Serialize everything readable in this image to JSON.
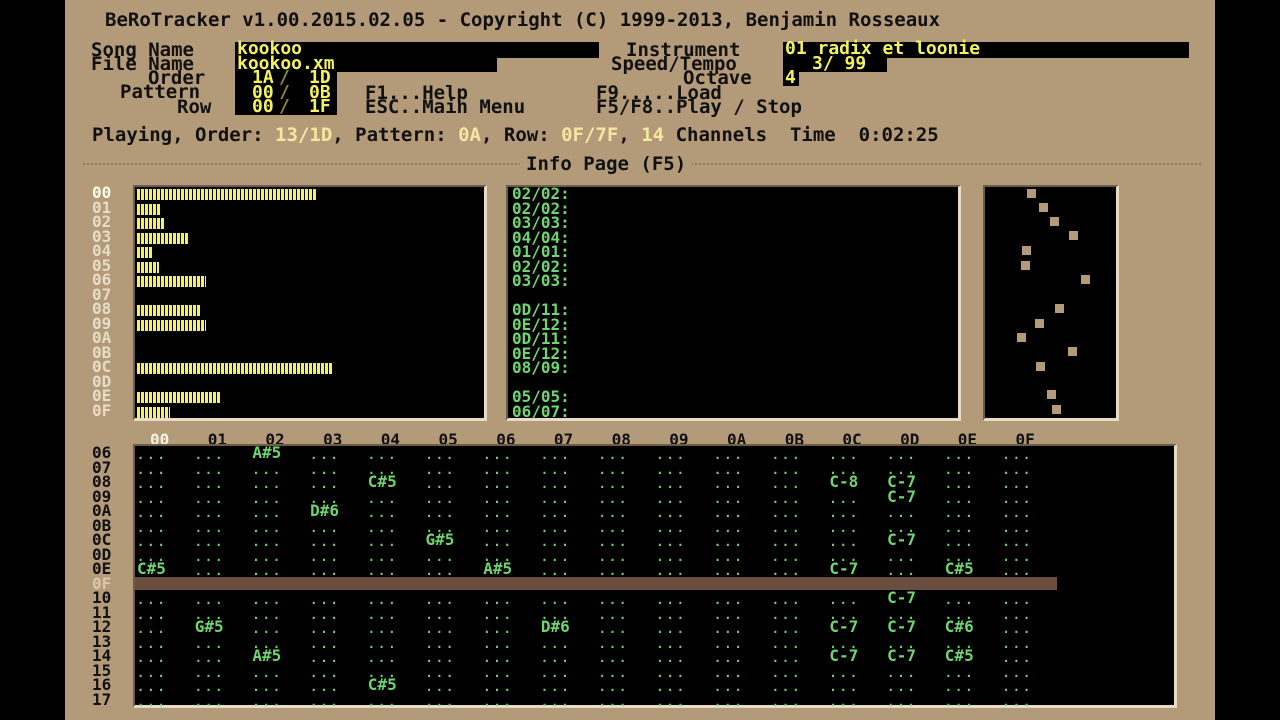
{
  "header": {
    "title": "BeRoTracker v1.00.2015.02.05 - Copyright (C) 1999-2013, Benjamin Rosseaux"
  },
  "song": {
    "song_name_label": "Song Name",
    "song_name": "kookoo",
    "file_name_label": "File Name",
    "file_name": "kookoo.xm",
    "order_label": "Order",
    "order_value": "1A",
    "order_total": "1D",
    "pattern_label": "Pattern",
    "pattern_value": "00",
    "pattern_total": "0B",
    "row_label": "Row",
    "row_value": "00",
    "row_total": "1F",
    "instrument_label": "Instrument",
    "instrument_value": "01 radix et loonie",
    "speed_label": "Speed/Tempo",
    "speed_value": "3/ 99",
    "octave_label": "Octave",
    "octave_value": "4"
  },
  "shortcuts": {
    "help": "F1...Help",
    "main_menu": "ESC..Main Menu",
    "load": "F9.....Load",
    "play_stop": "F5/F8..Play / Stop"
  },
  "status": {
    "playing_label": "Playing, Order:",
    "order_cur": "13",
    "order_total": "/1D",
    "pattern_label": ", Pattern:",
    "pattern": "0A",
    "row_label": ", Row:",
    "row_cur": "0F",
    "row_total": "/7F",
    "channels_sep": ",",
    "channels": "14",
    "channels_label": "Channels",
    "time_label": "Time",
    "time": "0:02:25"
  },
  "info_page": {
    "title": "Info Page (F5)"
  },
  "channels": [
    {
      "id": "00",
      "level": 0.92
    },
    {
      "id": "01",
      "level": 0.12
    },
    {
      "id": "02",
      "level": 0.14
    },
    {
      "id": "03",
      "level": 0.26
    },
    {
      "id": "04",
      "level": 0.08
    },
    {
      "id": "05",
      "level": 0.11
    },
    {
      "id": "06",
      "level": 0.35
    },
    {
      "id": "07",
      "level": 0
    },
    {
      "id": "08",
      "level": 0.32
    },
    {
      "id": "09",
      "level": 0.35
    },
    {
      "id": "0A",
      "level": 0
    },
    {
      "id": "0B",
      "level": 0
    },
    {
      "id": "0C",
      "level": 1.0
    },
    {
      "id": "0D",
      "level": 0
    },
    {
      "id": "0E",
      "level": 0.43
    },
    {
      "id": "0F",
      "level": 0.17
    }
  ],
  "sample_slots": [
    "02/02:",
    "02/02:",
    "03/03:",
    "04/04:",
    "01/01:",
    "02/02:",
    "03/03:",
    "",
    "0D/11:",
    "0E/12:",
    "0D/11:",
    "0E/12:",
    "08/09:",
    "",
    "05/05:",
    "06/07:"
  ],
  "pattern_columns": [
    "00",
    "01",
    "02",
    "03",
    "04",
    "05",
    "06",
    "07",
    "08",
    "09",
    "0A",
    "0B",
    "0C",
    "0D",
    "0E",
    "0F"
  ],
  "pattern_rows": [
    {
      "row": "06",
      "cells": {
        "02": "A#5"
      }
    },
    {
      "row": "07",
      "cells": {}
    },
    {
      "row": "08",
      "cells": {
        "04": "C#5",
        "0C": "C-8",
        "0D": "C-7"
      }
    },
    {
      "row": "09",
      "cells": {
        "0D": "C-7"
      }
    },
    {
      "row": "0A",
      "cells": {
        "03": "D#6"
      }
    },
    {
      "row": "0B",
      "cells": {}
    },
    {
      "row": "0C",
      "cells": {
        "05": "G#5",
        "0D": "C-7"
      }
    },
    {
      "row": "0D",
      "cells": {}
    },
    {
      "row": "0E",
      "cells": {
        "00": "C#5",
        "06": "A#5",
        "0C": "C-7",
        "0E": "C#5"
      }
    },
    {
      "row": "0F",
      "cells": {}
    },
    {
      "row": "10",
      "cells": {
        "0D": "C-7"
      }
    },
    {
      "row": "11",
      "cells": {}
    },
    {
      "row": "12",
      "cells": {
        "01": "G#5",
        "07": "D#6",
        "0C": "C-7",
        "0D": "C-7",
        "0E": "C#6"
      }
    },
    {
      "row": "13",
      "cells": {}
    },
    {
      "row": "14",
      "cells": {
        "02": "A#5",
        "0C": "C-7",
        "0D": "C-7",
        "0E": "C#5"
      }
    },
    {
      "row": "15",
      "cells": {}
    },
    {
      "row": "16",
      "cells": {
        "04": "C#5"
      }
    },
    {
      "row": "17",
      "cells": {}
    }
  ],
  "colors": {
    "background": "#b39a79",
    "value": "#f4f25c",
    "note": "#6ed66e",
    "cursor_row": "#6b4f3e"
  }
}
